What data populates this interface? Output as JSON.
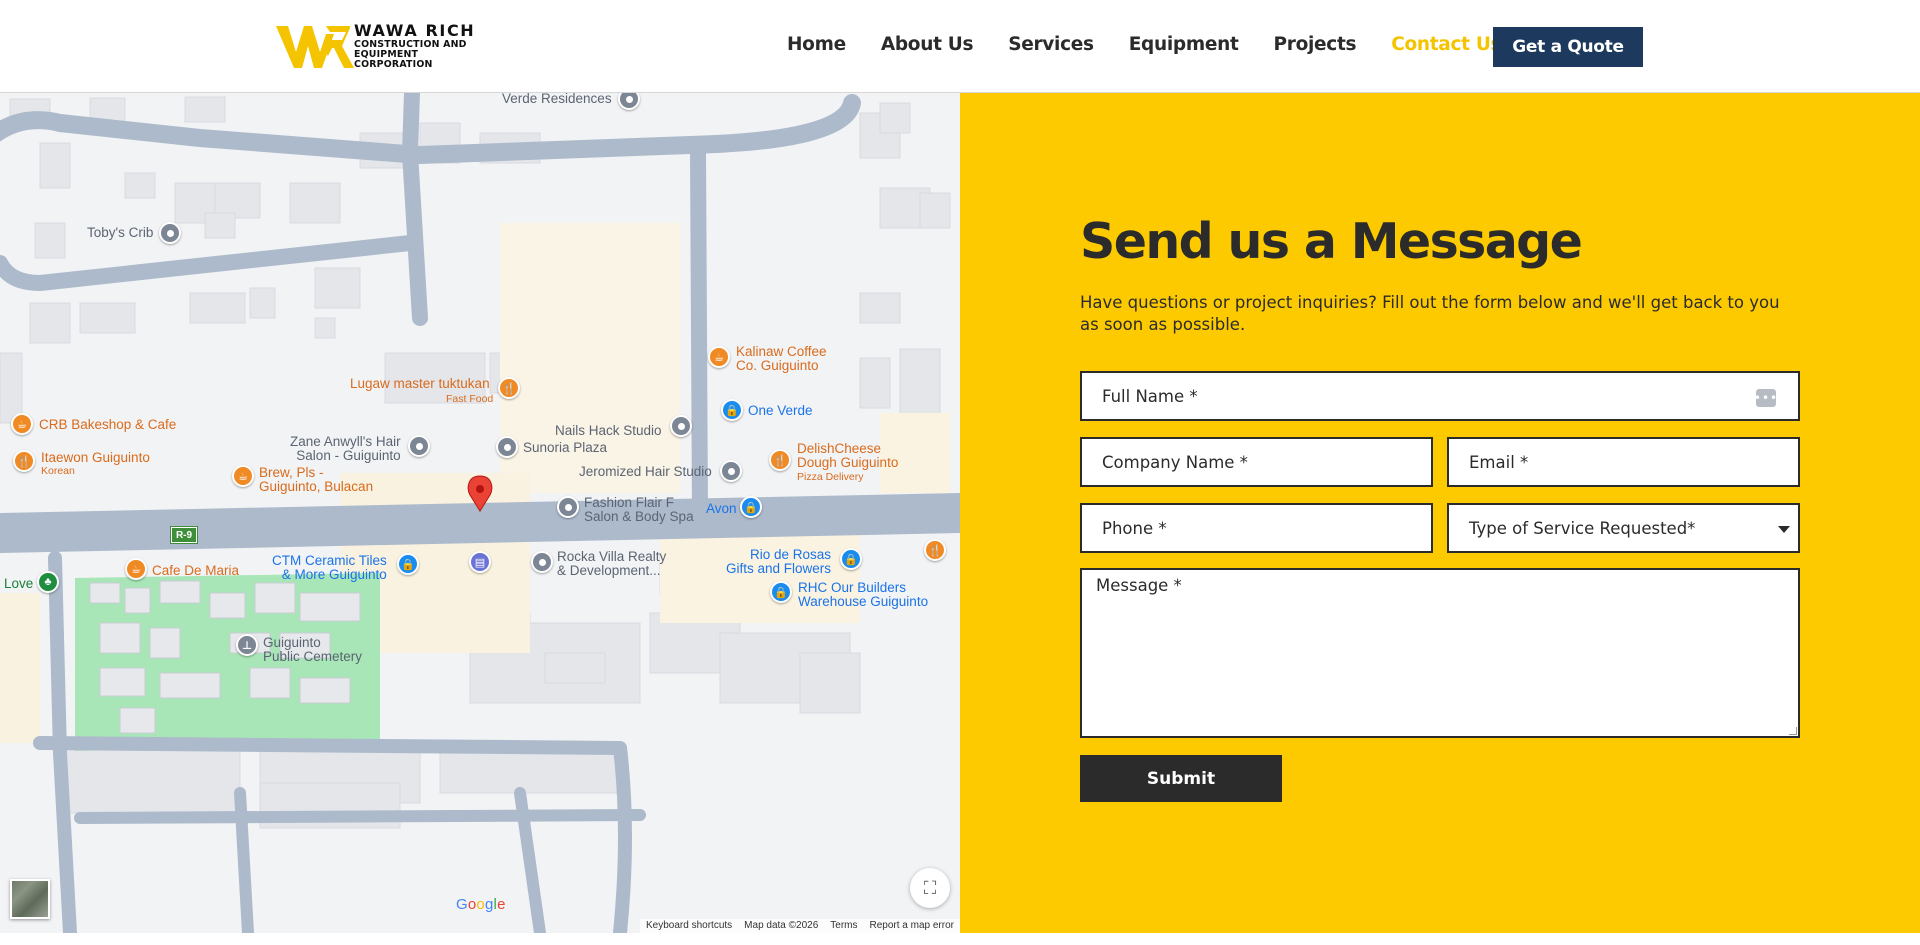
{
  "brand": {
    "title": "WAWA RICH",
    "subtitle": "CONSTRUCTION AND EQUIPMENT CORPORATION",
    "logo_icon": "wr-monogram-icon",
    "accent_color": "#fdca00",
    "navy_color": "#1d3a5e"
  },
  "nav": {
    "items": [
      {
        "label": "Home"
      },
      {
        "label": "About Us"
      },
      {
        "label": "Services"
      },
      {
        "label": "Equipment"
      },
      {
        "label": "Projects"
      },
      {
        "label": "Contact Us",
        "active": true
      }
    ],
    "cta_label": "Get a Quote"
  },
  "map": {
    "places": [
      "Verde Residences",
      "Toby's Crib",
      "Kalinaw Coffee\nCo. Guiguinto",
      "Lugaw master tuktukan",
      "Fast Food",
      "One Verde",
      "CRB Bakeshop & Cafe",
      "Zane Anwyll's Hair\nSalon - Guiguinto",
      "Nails Hack Studio",
      "Sunoria Plaza",
      "Itaewon Guiguinto",
      "Korean",
      "Brew, Pls -\nGuiguinto, Bulacan",
      "Jeromized Hair Studio",
      "DelishCheese\nDough Guiguinto",
      "Pizza Delivery",
      "Fashion Flair F\nSalon & Body Spa",
      "Avon",
      "CTM Ceramic Tiles\n& More Guiguinto",
      "Rocka Villa Realty\n& Development...",
      "Rio de Rosas\nGifts and Flowers",
      "Cafe De Maria",
      "Love",
      "RHC Our Builders\nWarehouse Guiguinto",
      "Guiguinto\nPublic Cemetery"
    ],
    "road_badge": "R-9",
    "google_letters": [
      "G",
      "o",
      "o",
      "g",
      "l",
      "e"
    ],
    "footer": [
      "Keyboard shortcuts",
      "Map data ©2026",
      "Terms",
      "Report a map error"
    ]
  },
  "form": {
    "title": "Send us a Message",
    "description": "Have questions or project inquiries? Fill out the form below and we'll get back to you as soon as possible.",
    "full_name_placeholder": "Full Name *",
    "company_placeholder": "Company Name *",
    "email_placeholder": "Email *",
    "phone_placeholder": "Phone *",
    "service_selected": "Type of Service Requested*",
    "message_placeholder": "Message *",
    "submit_label": "Submit"
  }
}
